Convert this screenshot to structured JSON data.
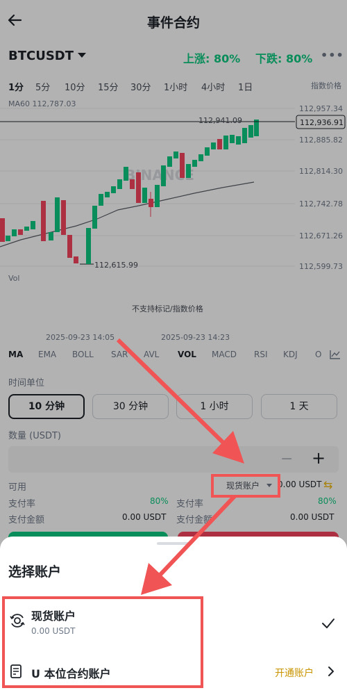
{
  "header": {
    "title": "事件合约"
  },
  "market": {
    "symbol": "BTCUSDT",
    "up": "上涨: 80%",
    "down": "下跌: 80%"
  },
  "intervals": [
    "1分",
    "5分",
    "10分",
    "15分",
    "30分",
    "1小时",
    "4小时",
    "1日"
  ],
  "index_price_label": "指数价格",
  "chart": {
    "ma_label": "MA60 112,787.03",
    "price_ticks": [
      "112,957.34",
      "112,885.82",
      "112,814.30",
      "112,742.78",
      "112,671.26",
      "112,599.73"
    ],
    "current_price": "112,936.91",
    "high_label": "112,941.09",
    "low_label": "112,615.99",
    "watermark": "BINANCE",
    "vol_label": "Vol",
    "vol_note": "不支持标记/指数价格",
    "time_labels": [
      "2025-09-23 14:05",
      "2025-09-23 14:23"
    ]
  },
  "indicators": [
    "MA",
    "EMA",
    "BOLL",
    "SAR",
    "AVL",
    "VOL",
    "MACD",
    "RSI",
    "KDJ",
    "O"
  ],
  "time_unit": {
    "label": "时间单位",
    "options": [
      "10 分钟",
      "30 分钟",
      "1 小时",
      "1 天"
    ]
  },
  "quantity": {
    "label": "数量 (USDT)",
    "minus": "−",
    "plus": "+"
  },
  "available": {
    "label": "可用",
    "account": "现货账户",
    "value": "0.00 USDT"
  },
  "payout": {
    "rate_label": "支付率",
    "rate_left": "80%",
    "rate_right": "80%",
    "amount_label": "支付金额",
    "amount_left": "0.00 USDT",
    "amount_right": "0.00 USDT"
  },
  "sheet": {
    "title": "选择账户",
    "spot": {
      "name": "现货账户",
      "balance": "0.00 USDT"
    },
    "futures": {
      "name": "U 本位合约账户",
      "action": "开通账户"
    }
  },
  "colors": {
    "green": "#0ecb81",
    "red": "#f6465d",
    "gold": "#c99400",
    "annotation": "#f05454"
  }
}
